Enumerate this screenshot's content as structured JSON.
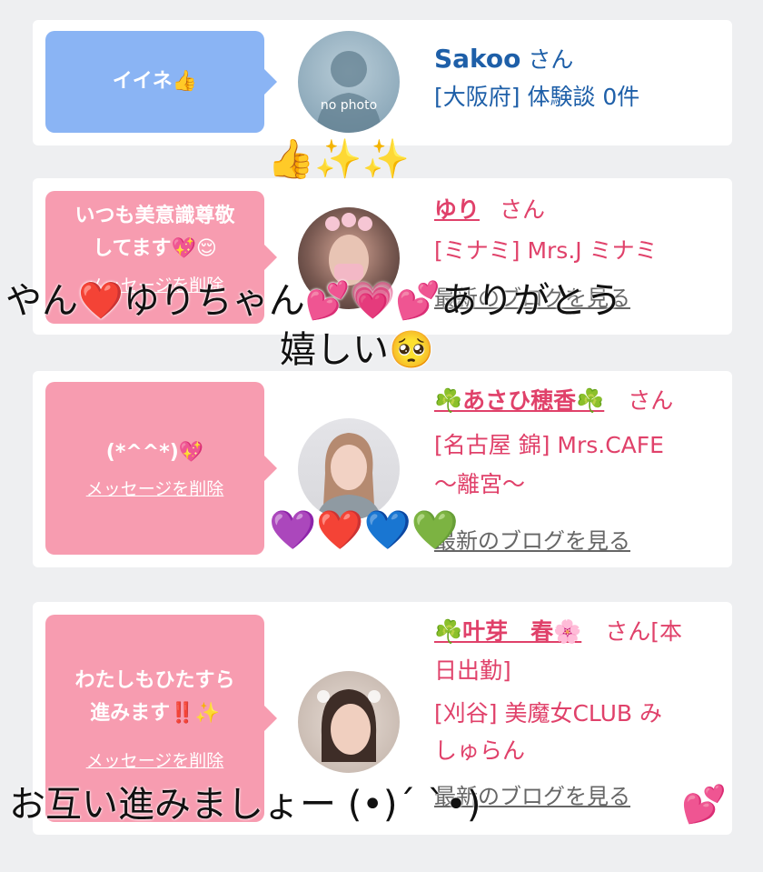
{
  "cards": [
    {
      "bubble_text": "イイネ👍",
      "avatar_text": "no photo",
      "name": "Sakoo",
      "san": "さん",
      "meta": "[大阪府] 体験談 0件"
    },
    {
      "bubble_line1": "いつも美意識尊敬",
      "bubble_line2": "してます💖😌",
      "delete_label": "メッセージを削除",
      "name": "ゆり",
      "san": "さん",
      "meta": "[ミナミ] Mrs.J ミナミ",
      "blog_label": "最新のブログを見る"
    },
    {
      "bubble_text": "(*^^*)💖",
      "delete_label": "メッセージを削除",
      "name": "☘️あさひ穂香☘️",
      "san": "さん",
      "meta_line1": "[名古屋 錦] Mrs.CAFE",
      "meta_line2": "〜離宮〜",
      "blog_label": "最新のブログを見る"
    },
    {
      "bubble_line1": "わたしもひたすら",
      "bubble_line2": "進みます‼️✨",
      "delete_label": "メッセージを削除",
      "name": "☘️叶芽　春🌸",
      "san_line1": "さん[本",
      "san_line2": "日出勤]",
      "meta_line1": "[刈谷] 美魔女CLUB み",
      "meta_line2": "しゅらん",
      "blog_label": "最新のブログを見る"
    }
  ],
  "overlays": {
    "sparkle": "👍✨✨",
    "line1": "やん❤️ゆりちゃん💕💗💕ありがとう",
    "line2": "嬉しい🥺",
    "hearts": "💜❤️💙💚",
    "line3": "お互い進みましょー (•)´ `•)",
    "heart_end": "💕"
  }
}
